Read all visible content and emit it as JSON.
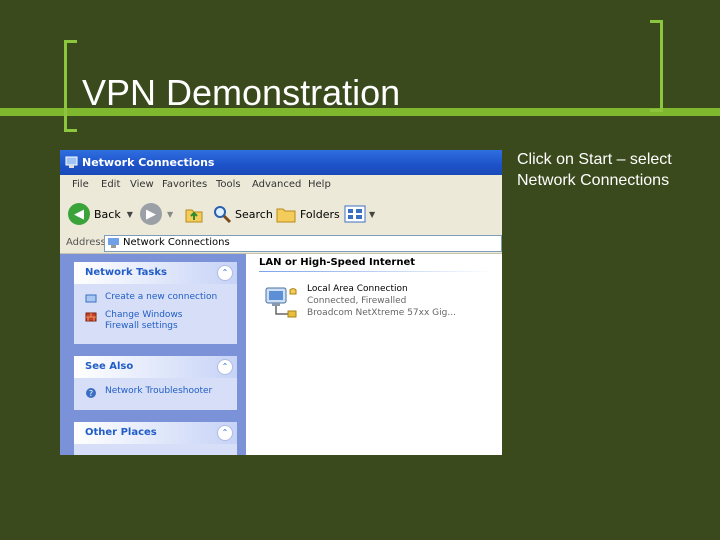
{
  "slide": {
    "title": "VPN Demonstration",
    "side_text": "Click on Start – select Network Connections"
  },
  "window": {
    "title": "Network Connections",
    "menu": [
      "File",
      "Edit",
      "View",
      "Favorites",
      "Tools",
      "Advanced",
      "Help"
    ],
    "toolbar": {
      "back_label": "Back",
      "search_label": "Search",
      "folders_label": "Folders"
    },
    "address": {
      "label": "Address",
      "value": "Network Connections"
    }
  },
  "task_panel": {
    "network_tasks": {
      "header": "Network Tasks",
      "items": [
        "Create a new connection",
        "Change Windows Firewall settings"
      ]
    },
    "see_also": {
      "header": "See Also",
      "items": [
        "Network Troubleshooter"
      ]
    },
    "other_places": {
      "header": "Other Places"
    }
  },
  "content": {
    "section_title": "LAN or High-Speed Internet",
    "connection": {
      "name": "Local Area Connection",
      "status": "Connected, Firewalled",
      "device": "Broadcom NetXtreme 57xx Gig..."
    }
  },
  "colors": {
    "background": "#3a4a1c",
    "accent": "#8cc63f",
    "xp_blue": "#215dc6"
  }
}
